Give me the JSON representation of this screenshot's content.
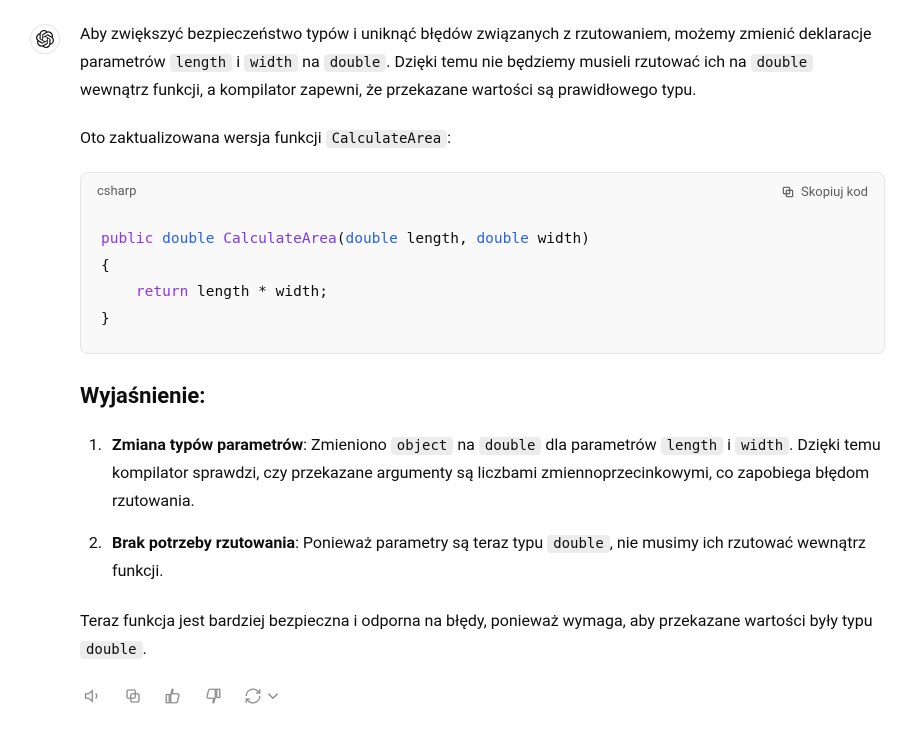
{
  "message": {
    "para1": {
      "t1": "Aby zwiększyć bezpieczeństwo typów i uniknąć błędów związanych z rzutowaniem, możemy zmienić deklaracje parametrów ",
      "c1": "length",
      "t2": " i ",
      "c2": "width",
      "t3": " na ",
      "c3": "double",
      "t4": ". Dzięki temu nie będziemy musieli rzutować ich na ",
      "c4": "double",
      "t5": " wewnątrz funkcji, a kompilator zapewni, że przekazane wartości są prawidłowego typu."
    },
    "para2": {
      "t1": "Oto zaktualizowana wersja funkcji ",
      "c1": "CalculateArea",
      "t2": ":"
    },
    "code": {
      "lang": "csharp",
      "copy_label": "Skopiuj kod",
      "tokens": {
        "kw_public": "public",
        "ty_double1": "double",
        "fn_name": "CalculateArea",
        "lp": "(",
        "ty_double2": "double",
        "p1": " length, ",
        "ty_double3": "double",
        "p2": " width",
        "rp": ")",
        "lb": "{",
        "kw_return": "return",
        "expr": " length * width;",
        "rb": "}"
      }
    },
    "heading": "Wyjaśnienie:",
    "list": [
      {
        "bold": "Zmiana typów parametrów",
        "t1": ": Zmieniono ",
        "c1": "object",
        "t2": " na ",
        "c2": "double",
        "t3": " dla parametrów ",
        "c3": "length",
        "t4": " i ",
        "c4": "width",
        "t5": ". Dzięki temu kompilator sprawdzi, czy przekazane argumenty są liczbami zmiennoprzecinkowymi, co zapobiega błędom rzutowania."
      },
      {
        "bold": "Brak potrzeby rzutowania",
        "t1": ": Ponieważ parametry są teraz typu ",
        "c1": "double",
        "t2": ", nie musimy ich rzutować wewnątrz funkcji."
      }
    ],
    "para3": {
      "t1": "Teraz funkcja jest bardziej bezpieczna i odporna na błędy, ponieważ wymaga, aby przekazane wartości były typu ",
      "c1": "double",
      "t2": "."
    }
  }
}
